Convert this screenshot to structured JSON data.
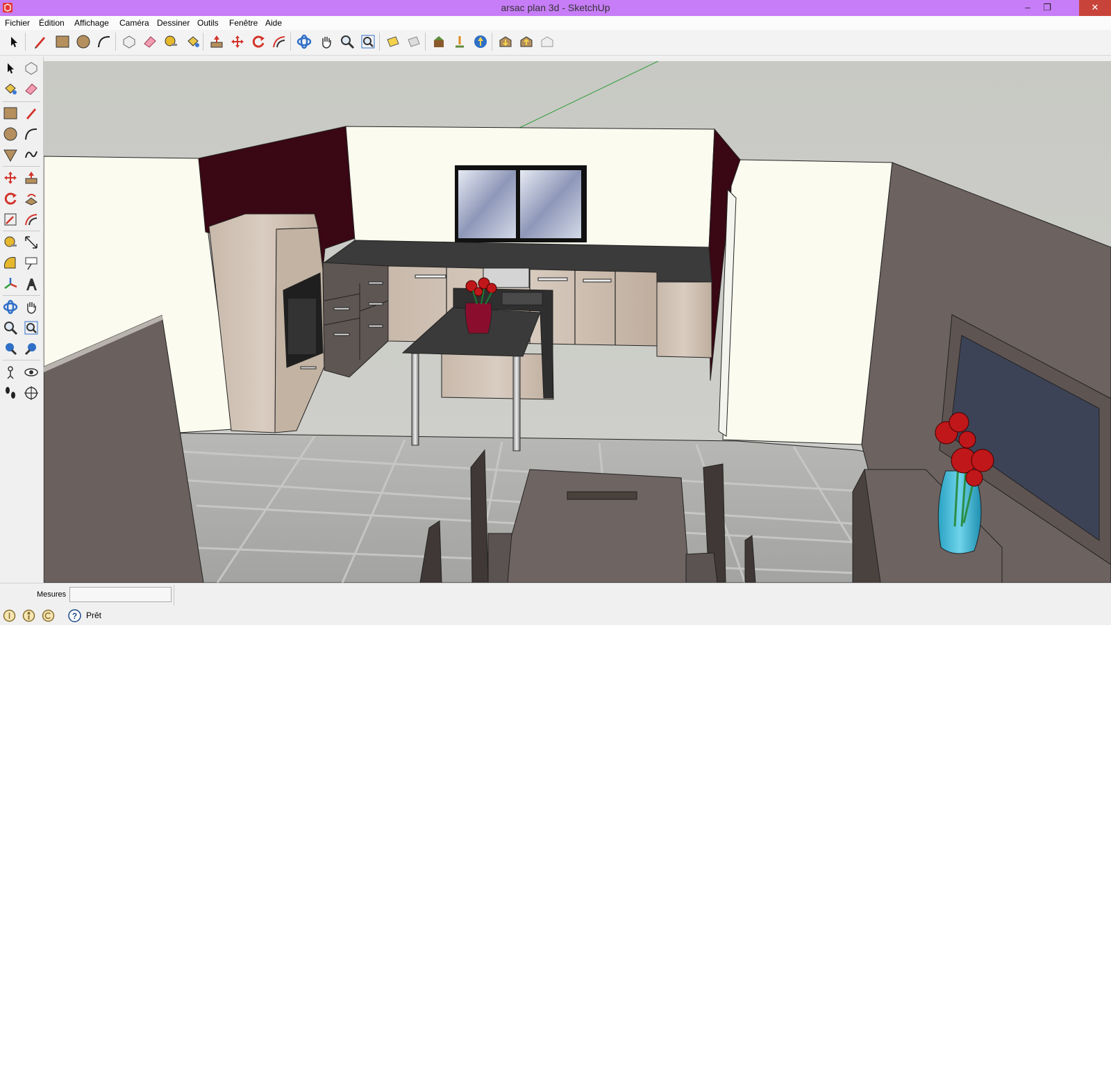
{
  "window": {
    "title": "arsac plan 3d - SketchUp",
    "controls": {
      "minimize": "–",
      "restore": "❐",
      "close": "✕"
    }
  },
  "menu": {
    "items": [
      "Fichier",
      "Édition",
      "Affichage",
      "Caméra",
      "Dessiner",
      "Outils",
      "Fenêtre",
      "Aide"
    ]
  },
  "toolbar": {
    "tools": [
      "select-icon",
      "pencil-icon",
      "rectangle-icon",
      "circle-icon",
      "arc-icon",
      "make-component-icon",
      "eraser-icon",
      "tape-measure-icon",
      "paint-bucket-icon",
      "push-pull-icon",
      "move-icon",
      "rotate-icon",
      "offset-icon",
      "orbit-icon",
      "pan-icon",
      "zoom-icon",
      "zoom-extents-icon",
      "previous-view-icon",
      "next-view-icon",
      "get-models-icon",
      "share-model-icon",
      "google-earth-icon",
      "warehouse-get-icon",
      "warehouse-share-icon",
      "extension-icon"
    ]
  },
  "left_toolbar": {
    "tools": [
      "select-icon",
      "make-component-icon",
      "paint-bucket-icon",
      "eraser-icon",
      "rectangle-icon",
      "line-icon",
      "circle-icon",
      "arc-icon",
      "polygon-icon",
      "freehand-icon",
      "move-icon",
      "push-pull-icon",
      "rotate-icon",
      "follow-me-icon",
      "scale-icon",
      "offset-icon",
      "tape-measure-icon",
      "dimension-icon",
      "protractor-icon",
      "text-icon",
      "axes-icon",
      "3d-text-icon",
      "orbit-icon",
      "pan-icon",
      "zoom-icon",
      "zoom-window-icon",
      "previous-icon",
      "next-icon",
      "position-camera-icon",
      "look-around-icon",
      "walk-icon",
      "section-plane-icon"
    ]
  },
  "measures": {
    "label": "Mesures",
    "value": ""
  },
  "status": {
    "text": "Prêt",
    "icons": [
      "geo-location-icon",
      "credits-icon",
      "copyright-icon",
      "help-icon"
    ]
  },
  "colors": {
    "titlebar": "#c77df7",
    "close": "#c8443b",
    "accent_wall": "#3a0714"
  }
}
